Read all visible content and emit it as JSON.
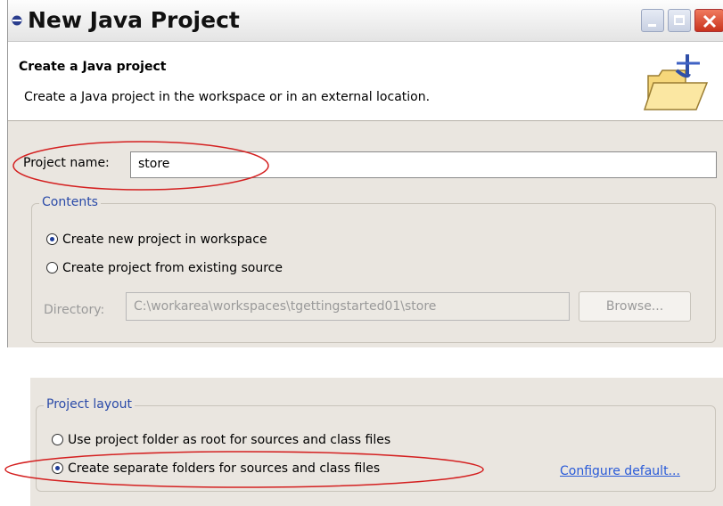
{
  "window": {
    "title": "New Java Project"
  },
  "header": {
    "title": "Create a Java project",
    "description": "Create a Java project in the workspace or in an external location."
  },
  "project_name": {
    "label": "Project name:",
    "value": "store"
  },
  "contents": {
    "title": "Contents",
    "options": [
      {
        "label": "Create new project in workspace",
        "checked": true
      },
      {
        "label": "Create project from existing source",
        "checked": false
      }
    ],
    "directory_label": "Directory:",
    "directory_value": "C:\\workarea\\workspaces\\tgettingstarted01\\store",
    "browse_label": "Browse..."
  },
  "project_layout": {
    "title": "Project layout",
    "options": [
      {
        "label": "Use project folder as root for sources and class files",
        "checked": false
      },
      {
        "label": "Create separate folders for sources and class files",
        "checked": true
      }
    ],
    "configure_link": "Configure default..."
  },
  "colors": {
    "annotation": "#d42020",
    "group_title": "#2a4aa8",
    "link": "#2a5bd8"
  }
}
